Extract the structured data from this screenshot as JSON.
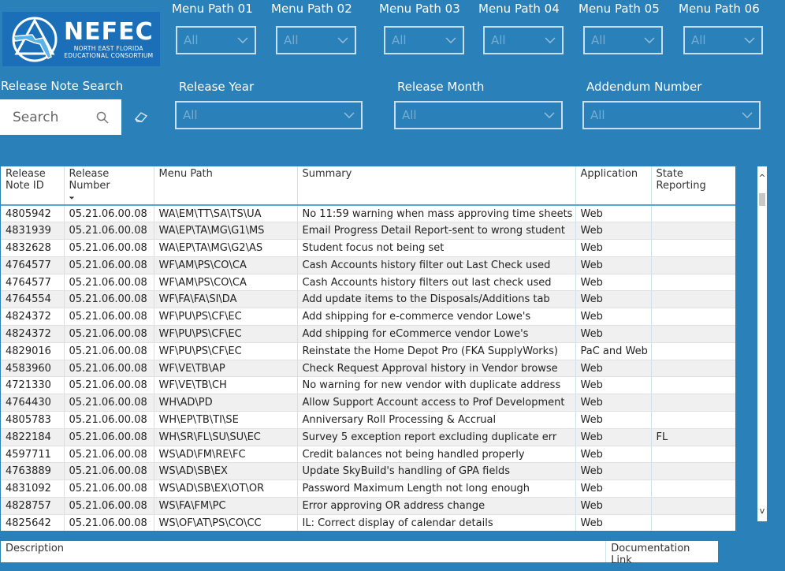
{
  "logo": {
    "name": "NEFEC",
    "subtitle_line1": "NORTH EAST FLORIDA",
    "subtitle_line2": "EDUCATIONAL CONSORTIUM"
  },
  "menu_paths": [
    {
      "label": "Menu Path 01",
      "value": "All"
    },
    {
      "label": "Menu Path 02",
      "value": "All"
    },
    {
      "label": "Menu Path 03",
      "value": "All"
    },
    {
      "label": "Menu Path 04",
      "value": "All"
    },
    {
      "label": "Menu Path 05",
      "value": "All"
    },
    {
      "label": "Menu Path 06",
      "value": "All"
    }
  ],
  "search": {
    "label": "Release Note Search",
    "placeholder": "Search"
  },
  "filters": {
    "release_year": {
      "label": "Release Year",
      "value": "All"
    },
    "release_month": {
      "label": "Release Month",
      "value": "All"
    },
    "addendum_number": {
      "label": "Addendum Number",
      "value": "All"
    }
  },
  "table": {
    "columns": [
      "Release Note ID",
      "Release Number",
      "Menu Path",
      "Summary",
      "Application",
      "State Reporting"
    ],
    "sort_indicator": "⏷",
    "rows": [
      [
        "4805942",
        "05.21.06.00.08",
        "WA\\EM\\TT\\SA\\TS\\UA",
        "No 11:59 warning when mass approving time sheets",
        "Web",
        ""
      ],
      [
        "4831939",
        "05.21.06.00.08",
        "WA\\EP\\TA\\MG\\G1\\MS",
        "Email Progress Detail Report-sent to wrong student",
        "Web",
        ""
      ],
      [
        "4832628",
        "05.21.06.00.08",
        "WA\\EP\\TA\\MG\\G2\\AS",
        "Student focus not being set",
        "Web",
        ""
      ],
      [
        "4764577",
        "05.21.06.00.08",
        "WF\\AM\\PS\\CO\\CA",
        "Cash Accounts history filter out Last Check used",
        "Web",
        ""
      ],
      [
        "4764577",
        "05.21.06.00.08",
        "WF\\AM\\PS\\CO\\CA",
        "Cash Accounts history filters out last check used",
        "Web",
        ""
      ],
      [
        "4764554",
        "05.21.06.00.08",
        "WF\\FA\\FA\\SI\\DA",
        "Add update items to the Disposals/Additions tab",
        "Web",
        ""
      ],
      [
        "4824372",
        "05.21.06.00.08",
        "WF\\PU\\PS\\CF\\EC",
        "Add shipping for e-commerce vendor Lowe's",
        "Web",
        ""
      ],
      [
        "4824372",
        "05.21.06.00.08",
        "WF\\PU\\PS\\CF\\EC",
        "Add shipping for eCommerce vendor Lowe's",
        "Web",
        ""
      ],
      [
        "4829016",
        "05.21.06.00.08",
        "WF\\PU\\PS\\CF\\EC",
        "Reinstate the Home Depot Pro (FKA SupplyWorks)",
        "PaC and Web",
        ""
      ],
      [
        "4583960",
        "05.21.06.00.08",
        "WF\\VE\\TB\\AP",
        "Check Request Approval history in Vendor browse",
        "Web",
        ""
      ],
      [
        "4721330",
        "05.21.06.00.08",
        "WF\\VE\\TB\\CH",
        "No warning for new vendor with duplicate address",
        "Web",
        ""
      ],
      [
        "4764430",
        "05.21.06.00.08",
        "WH\\AD\\PD",
        "Allow Support Account access to Prof Development",
        "Web",
        ""
      ],
      [
        "4805783",
        "05.21.06.00.08",
        "WH\\EP\\TB\\TI\\SE",
        "Anniversary Roll Processing & Accrual",
        "Web",
        ""
      ],
      [
        "4822184",
        "05.21.06.00.08",
        "WH\\SR\\FL\\SU\\SU\\EC",
        "Survey 5 exception report excluding duplicate err",
        "Web",
        "FL"
      ],
      [
        "4597711",
        "05.21.06.00.08",
        "WS\\AD\\FM\\RE\\FC",
        "Credit balances not being handled properly",
        "Web",
        ""
      ],
      [
        "4763889",
        "05.21.06.00.08",
        "WS\\AD\\SB\\EX",
        "Update SkyBuild's handling of GPA fields",
        "Web",
        ""
      ],
      [
        "4831092",
        "05.21.06.00.08",
        "WS\\AD\\SB\\EX\\OT\\OR",
        "Password Maximum Length not long enough",
        "Web",
        ""
      ],
      [
        "4828757",
        "05.21.06.00.08",
        "WS\\FA\\FM\\PC",
        "Error approving OR address change",
        "Web",
        ""
      ],
      [
        "4825642",
        "05.21.06.00.08",
        "WS\\OF\\AT\\PS\\CO\\CC",
        "IL: Correct display of calendar details",
        "Web",
        ""
      ]
    ]
  },
  "scrollbar": {
    "up": "^",
    "down": "v"
  },
  "bottom_table": {
    "description": "Description",
    "documentation_link": "Documentation Link"
  }
}
